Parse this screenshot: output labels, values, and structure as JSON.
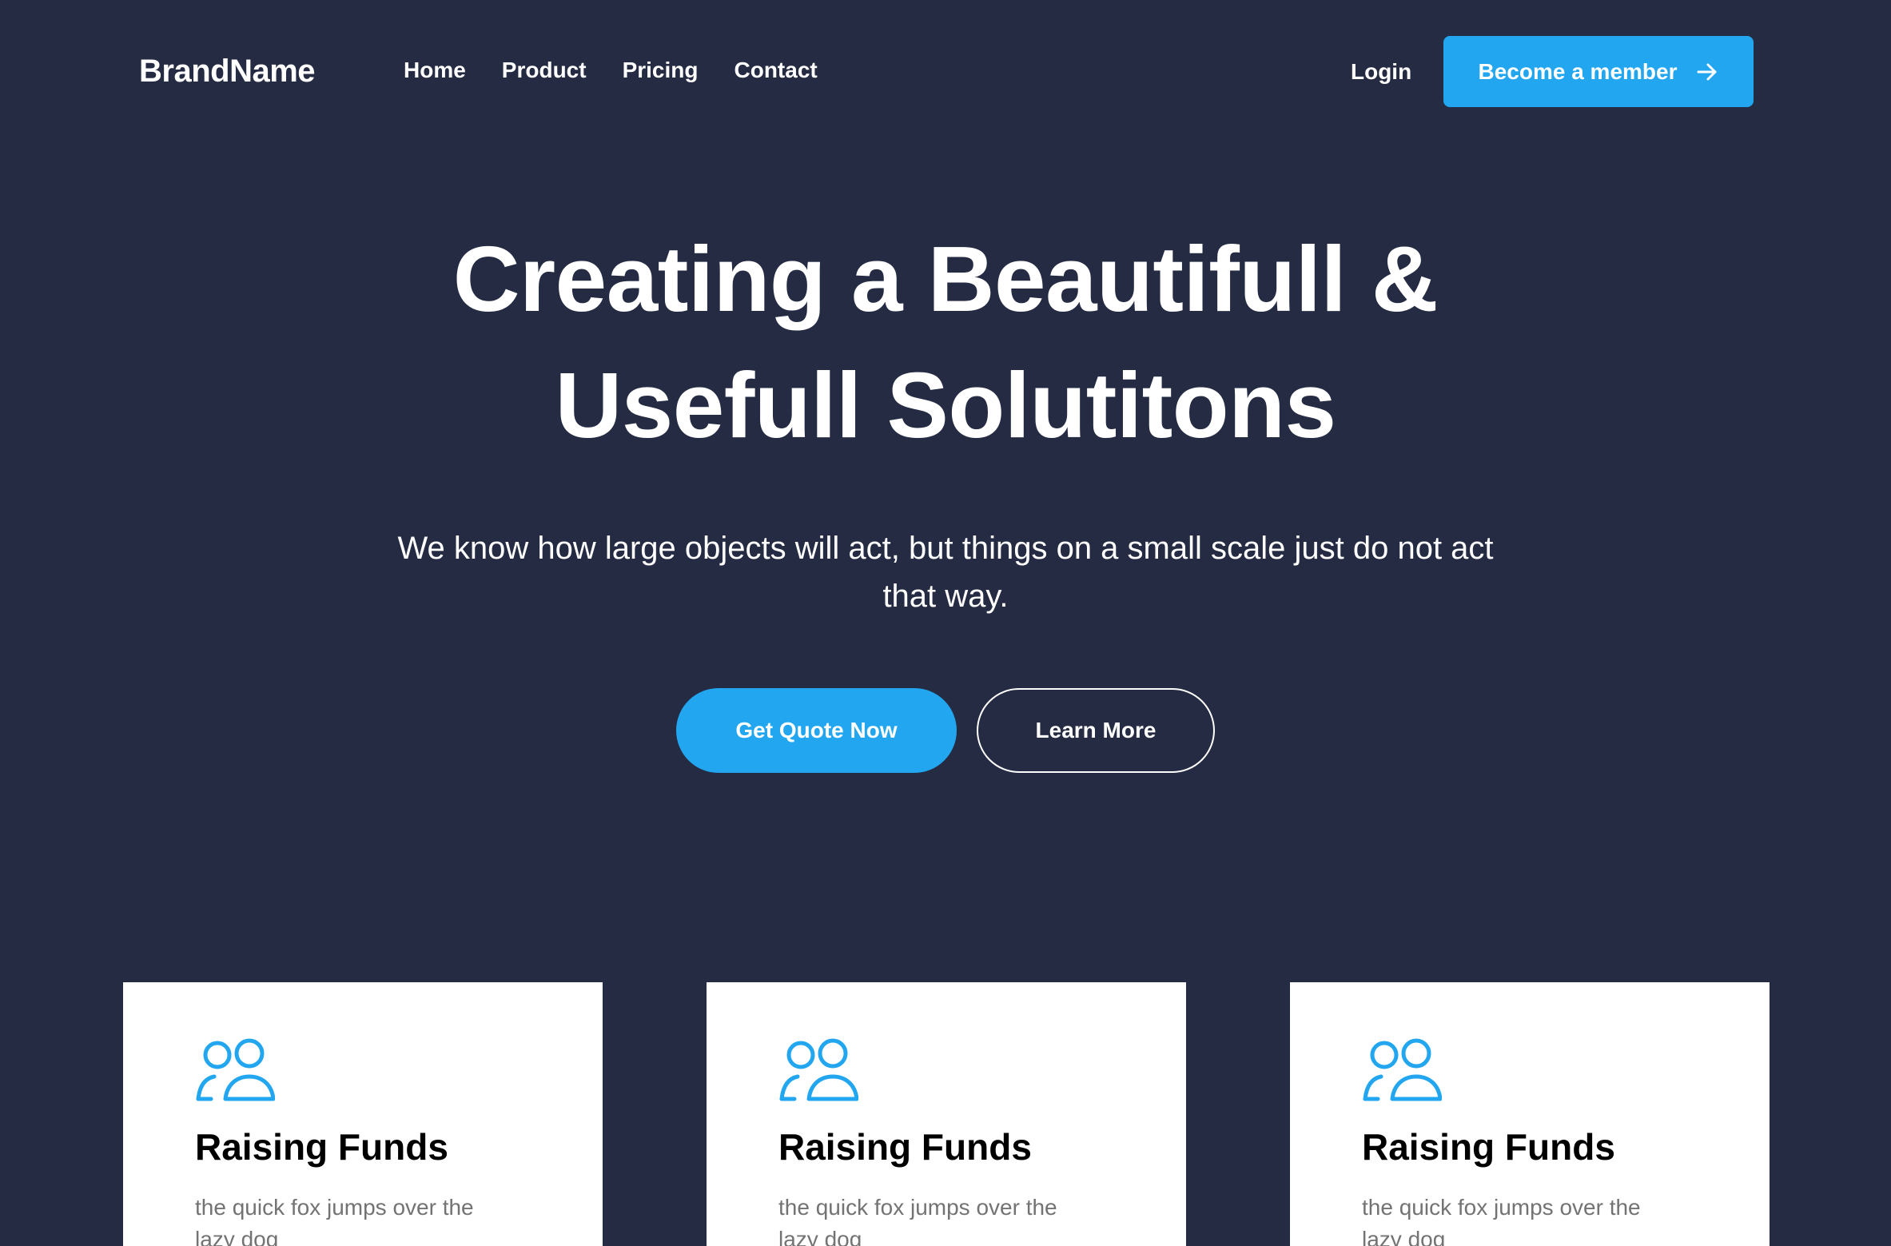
{
  "header": {
    "brand": "BrandName",
    "nav": [
      "Home",
      "Product",
      "Pricing",
      "Contact"
    ],
    "login_label": "Login",
    "member_button": {
      "label": "Become a member",
      "icon": "arrow-right-icon"
    }
  },
  "hero": {
    "title": "Creating a Beautifull & Usefull Solutitons",
    "subtitle": "We know how large objects will act, but things on a small scale just do not act that way.",
    "primary_cta": "Get Quote Now",
    "secondary_cta": "Learn More"
  },
  "cards": [
    {
      "icon": "users-icon",
      "title": "Raising Funds",
      "text": "the quick fox jumps over the lazy dog"
    },
    {
      "icon": "users-icon",
      "title": "Raising Funds",
      "text": "the quick fox jumps over the lazy dog"
    },
    {
      "icon": "users-icon",
      "title": "Raising Funds",
      "text": "the quick fox jumps over the lazy dog"
    }
  ],
  "colors": {
    "background": "#252b42",
    "accent": "#23a6f0",
    "card_background": "#ffffff",
    "card_text": "#737373"
  }
}
